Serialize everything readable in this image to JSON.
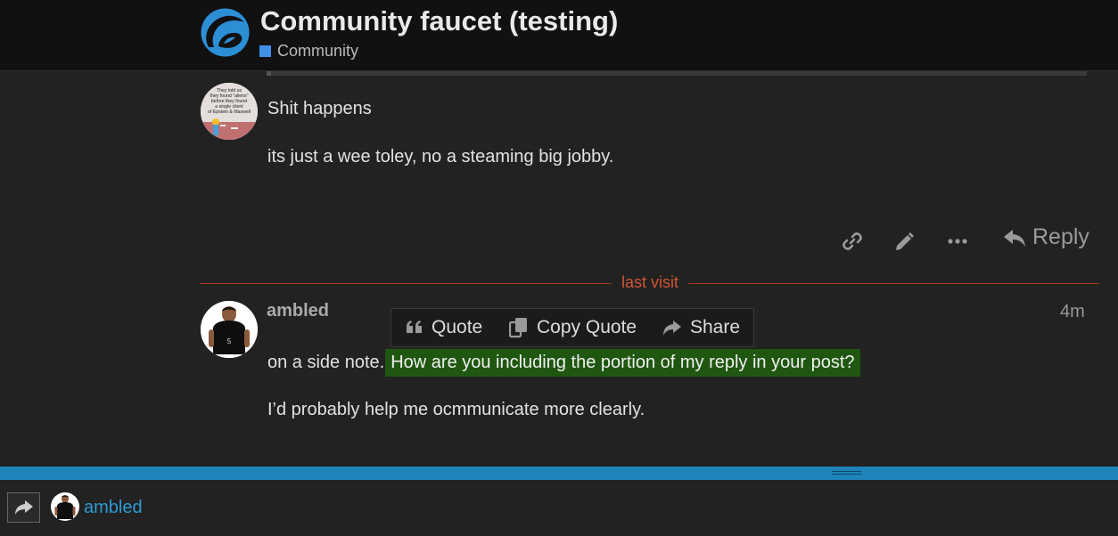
{
  "header": {
    "topic_title": "Community faucet (testing)",
    "category": "Community",
    "category_color": "#3f90e6",
    "logo_icon": "site-logo-icon"
  },
  "posts": [
    {
      "avatar_text": [
        "They told us",
        "they found \"aliens\"",
        "before they found",
        "a single client",
        "of Epstein & Maxwell"
      ],
      "paragraphs": [
        "Shit happens",
        "its just a wee toley, no a steaming big jobby."
      ],
      "actions": {
        "link_icon": "link-icon",
        "edit_icon": "pencil-icon",
        "more_icon": "ellipsis-icon",
        "reply_icon": "reply-arrow-icon",
        "reply_label": "Reply"
      }
    },
    {
      "username": "ambled",
      "date": "4m",
      "avatar_number": "5",
      "paragraph_1_plain": "on a side note.",
      "paragraph_1_selected": "How are you including the portion of my reply in your post?",
      "paragraph_2": "I’d probably help me ocmmunicate more clearly."
    }
  ],
  "last_visit_label": "last visit",
  "quote_toolbar": {
    "quote_label": "Quote",
    "copy_quote_label": "Copy Quote",
    "share_label": "Share"
  },
  "composer": {
    "reply_to_user": "ambled",
    "accent_color": "#1e84ba"
  }
}
